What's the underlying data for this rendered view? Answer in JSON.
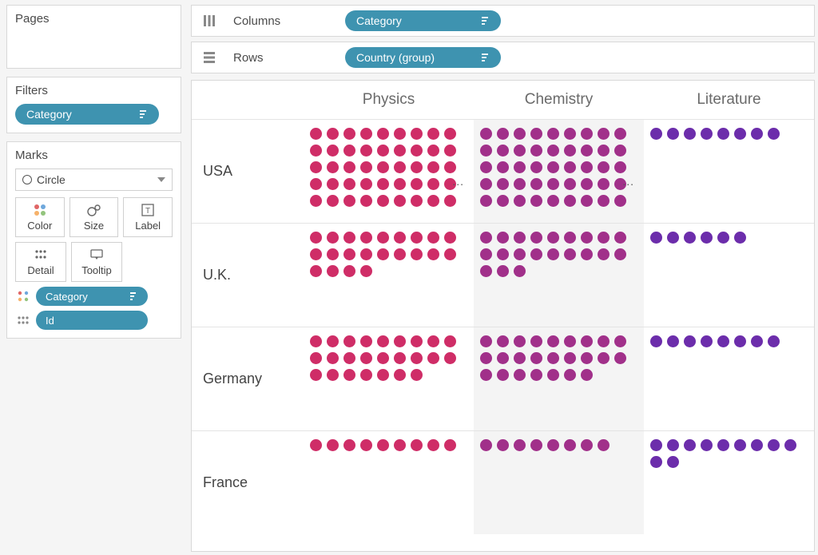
{
  "sidebar": {
    "pages_label": "Pages",
    "filters_label": "Filters",
    "filter_pill": "Category",
    "marks_label": "Marks",
    "mark_type": "Circle",
    "buttons": {
      "color": "Color",
      "size": "Size",
      "label": "Label",
      "detail": "Detail",
      "tooltip": "Tooltip"
    },
    "mark_pills": [
      {
        "icon": "color-dots",
        "label": "Category"
      },
      {
        "icon": "detail-dots",
        "label": "Id"
      }
    ]
  },
  "shelves": {
    "columns_label": "Columns",
    "columns_pill": "Category",
    "rows_label": "Rows",
    "rows_pill": "Country (group)"
  },
  "chart_data": {
    "type": "dot-matrix",
    "categories": [
      "Physics",
      "Chemistry",
      "Literature"
    ],
    "category_colors": {
      "Physics": "#cf2d67",
      "Chemistry": "#a1308a",
      "Literature": "#6c2dab"
    },
    "rows": [
      {
        "country": "USA",
        "cells": [
          {
            "count": 45,
            "overflow": true
          },
          {
            "count": 45,
            "overflow": true
          },
          {
            "count": 8,
            "overflow": false
          }
        ]
      },
      {
        "country": "U.K.",
        "cells": [
          {
            "count": 22,
            "overflow": false
          },
          {
            "count": 21,
            "overflow": false
          },
          {
            "count": 6,
            "overflow": false
          }
        ]
      },
      {
        "country": "Germany",
        "cells": [
          {
            "count": 25,
            "overflow": false
          },
          {
            "count": 25,
            "overflow": false
          },
          {
            "count": 8,
            "overflow": false
          }
        ]
      },
      {
        "country": "France",
        "cells": [
          {
            "count": 9,
            "overflow": false
          },
          {
            "count": 8,
            "overflow": false
          },
          {
            "count": 11,
            "overflow": false
          }
        ]
      }
    ]
  }
}
